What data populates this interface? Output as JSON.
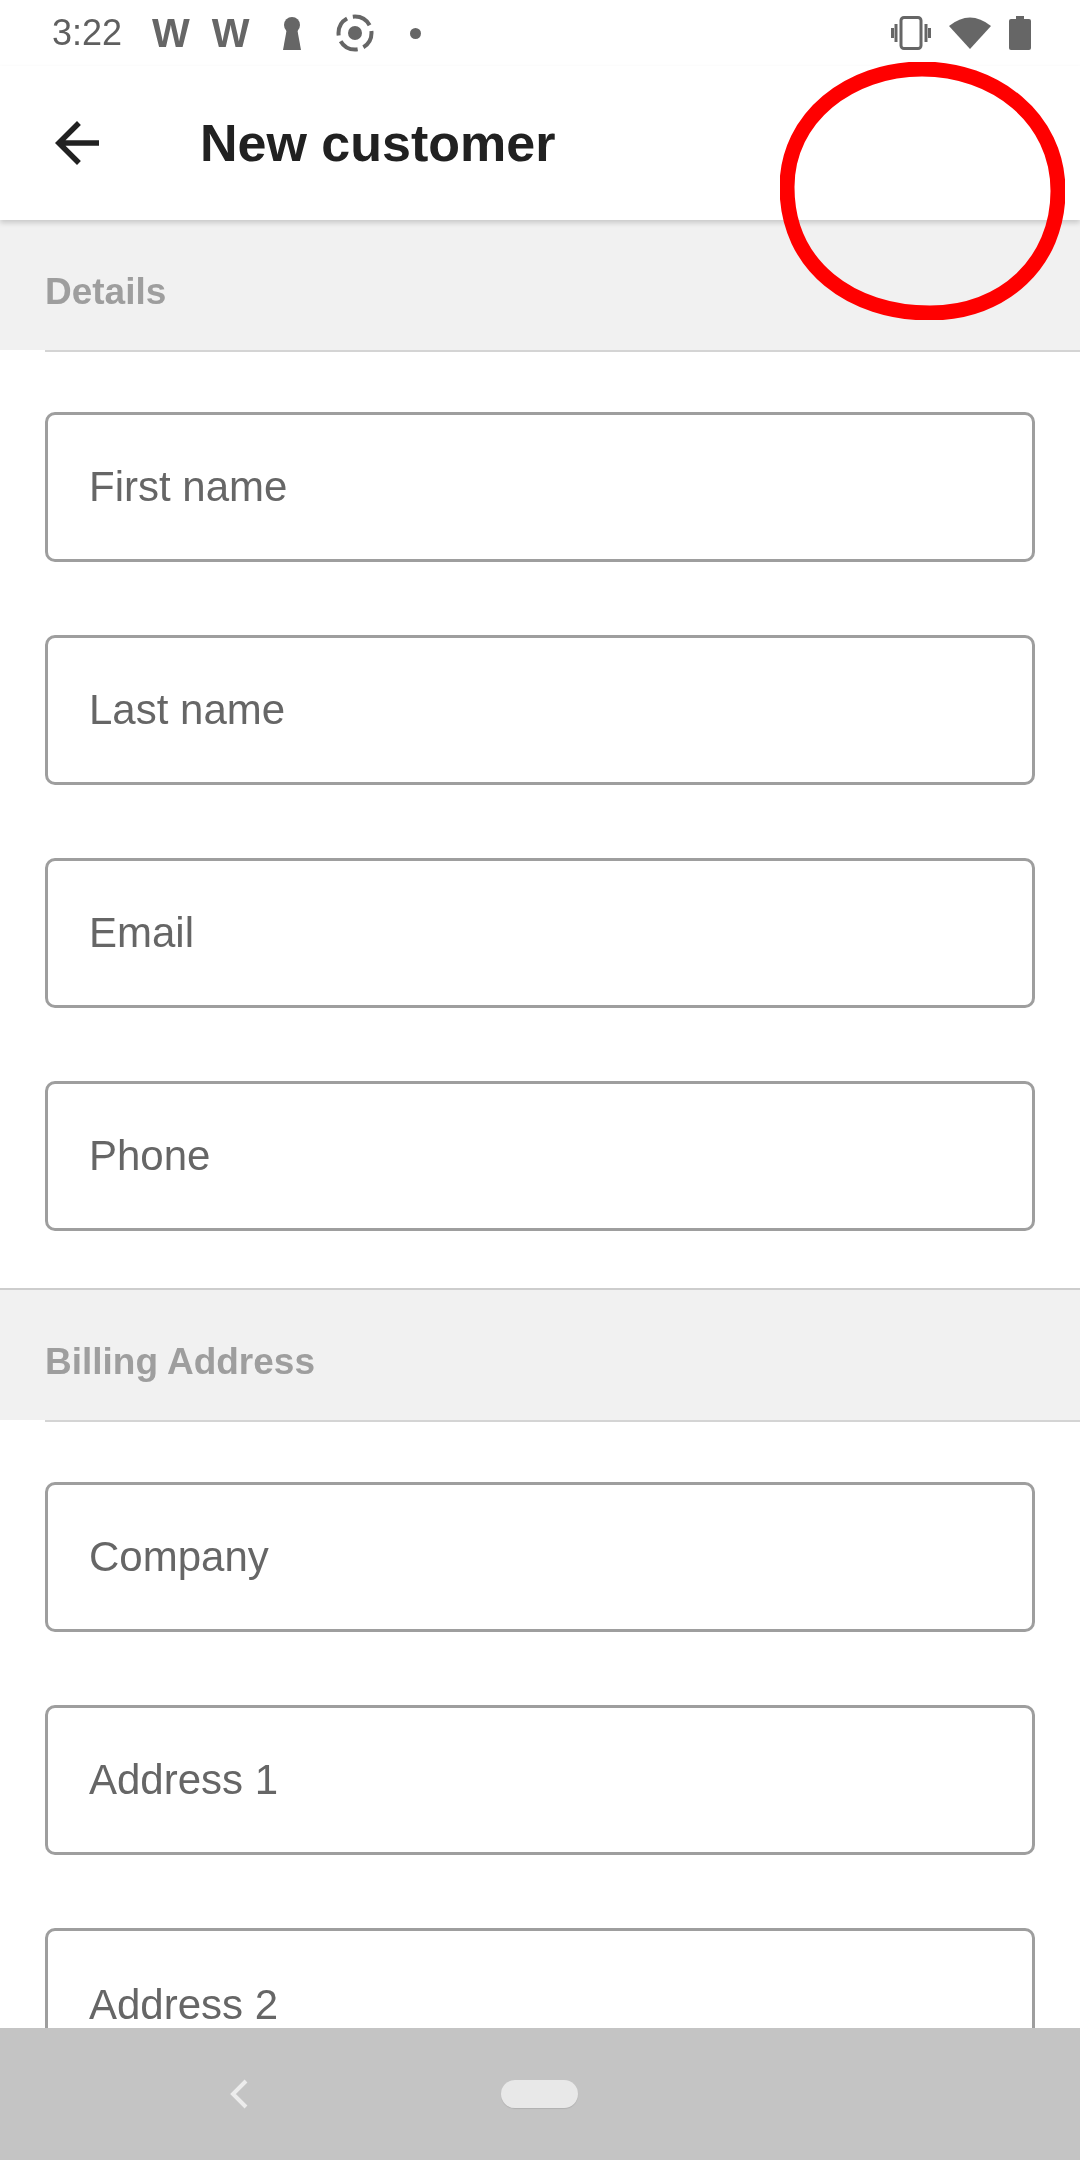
{
  "status_bar": {
    "time": "3:22",
    "notification_icons": [
      "W",
      "W"
    ]
  },
  "app_bar": {
    "title": "New customer"
  },
  "sections": [
    {
      "title": "Details",
      "fields": [
        {
          "placeholder": "First name"
        },
        {
          "placeholder": "Last name"
        },
        {
          "placeholder": "Email"
        },
        {
          "placeholder": "Phone"
        }
      ]
    },
    {
      "title": "Billing Address",
      "fields": [
        {
          "placeholder": "Company"
        },
        {
          "placeholder": "Address 1"
        },
        {
          "placeholder": "Address 2"
        }
      ]
    }
  ],
  "annotations": [
    {
      "kind": "circle"
    }
  ]
}
